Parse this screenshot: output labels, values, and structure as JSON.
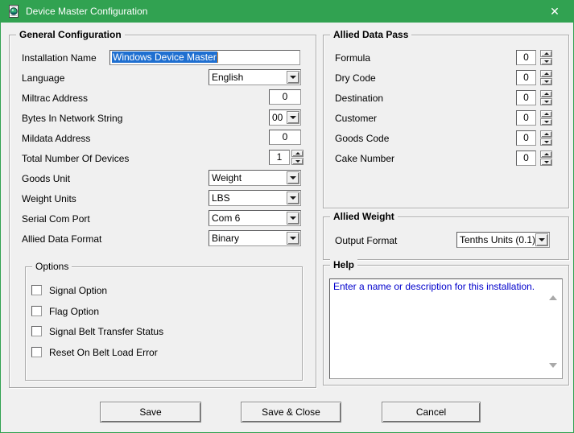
{
  "window": {
    "title": "Device Master Configuration",
    "close_glyph": "✕"
  },
  "colors": {
    "titlebar_green": "#31a251",
    "dialog_bg": "#f0f0f0",
    "selection_blue": "#1f6fd0",
    "help_text_blue": "#0000cc"
  },
  "general": {
    "title": "General Configuration",
    "fields": {
      "installation": {
        "label": "Installation Name",
        "value": "Windows Device Master"
      },
      "language": {
        "label": "Language",
        "value": "English"
      },
      "miltrac": {
        "label": "Miltrac Address",
        "value": "0"
      },
      "bytes": {
        "label": "Bytes In Network String",
        "value": "00"
      },
      "mildata": {
        "label": "Mildata Address",
        "value": "0"
      },
      "total_devices": {
        "label": "Total Number Of Devices",
        "value": "1"
      },
      "goods_unit": {
        "label": "Goods Unit",
        "value": "Weight"
      },
      "weight_units": {
        "label": "Weight Units",
        "value": "LBS"
      },
      "serial_port": {
        "label": "Serial Com Port",
        "value": "Com 6"
      },
      "data_format": {
        "label": "Allied Data Format",
        "value": "Binary"
      }
    }
  },
  "options": {
    "title": "Options",
    "items": [
      {
        "label": "Signal Option",
        "checked": false
      },
      {
        "label": "Flag Option",
        "checked": false
      },
      {
        "label": "Signal Belt Transfer Status",
        "checked": false
      },
      {
        "label": "Reset On Belt Load Error",
        "checked": false
      }
    ]
  },
  "allied_data_pass": {
    "title": "Allied Data Pass",
    "fields": [
      {
        "label": "Formula",
        "value": "0"
      },
      {
        "label": "Dry Code",
        "value": "0"
      },
      {
        "label": "Destination",
        "value": "0"
      },
      {
        "label": "Customer",
        "value": "0"
      },
      {
        "label": "Goods Code",
        "value": "0"
      },
      {
        "label": "Cake Number",
        "value": "0"
      }
    ]
  },
  "allied_weight": {
    "title": "Allied Weight",
    "output_format_label": "Output Format",
    "output_format_value": "Tenths Units (0.1)"
  },
  "help": {
    "title": "Help",
    "text": "Enter a name or description for this installation."
  },
  "buttons": {
    "save": "Save",
    "save_close": "Save & Close",
    "cancel": "Cancel"
  }
}
